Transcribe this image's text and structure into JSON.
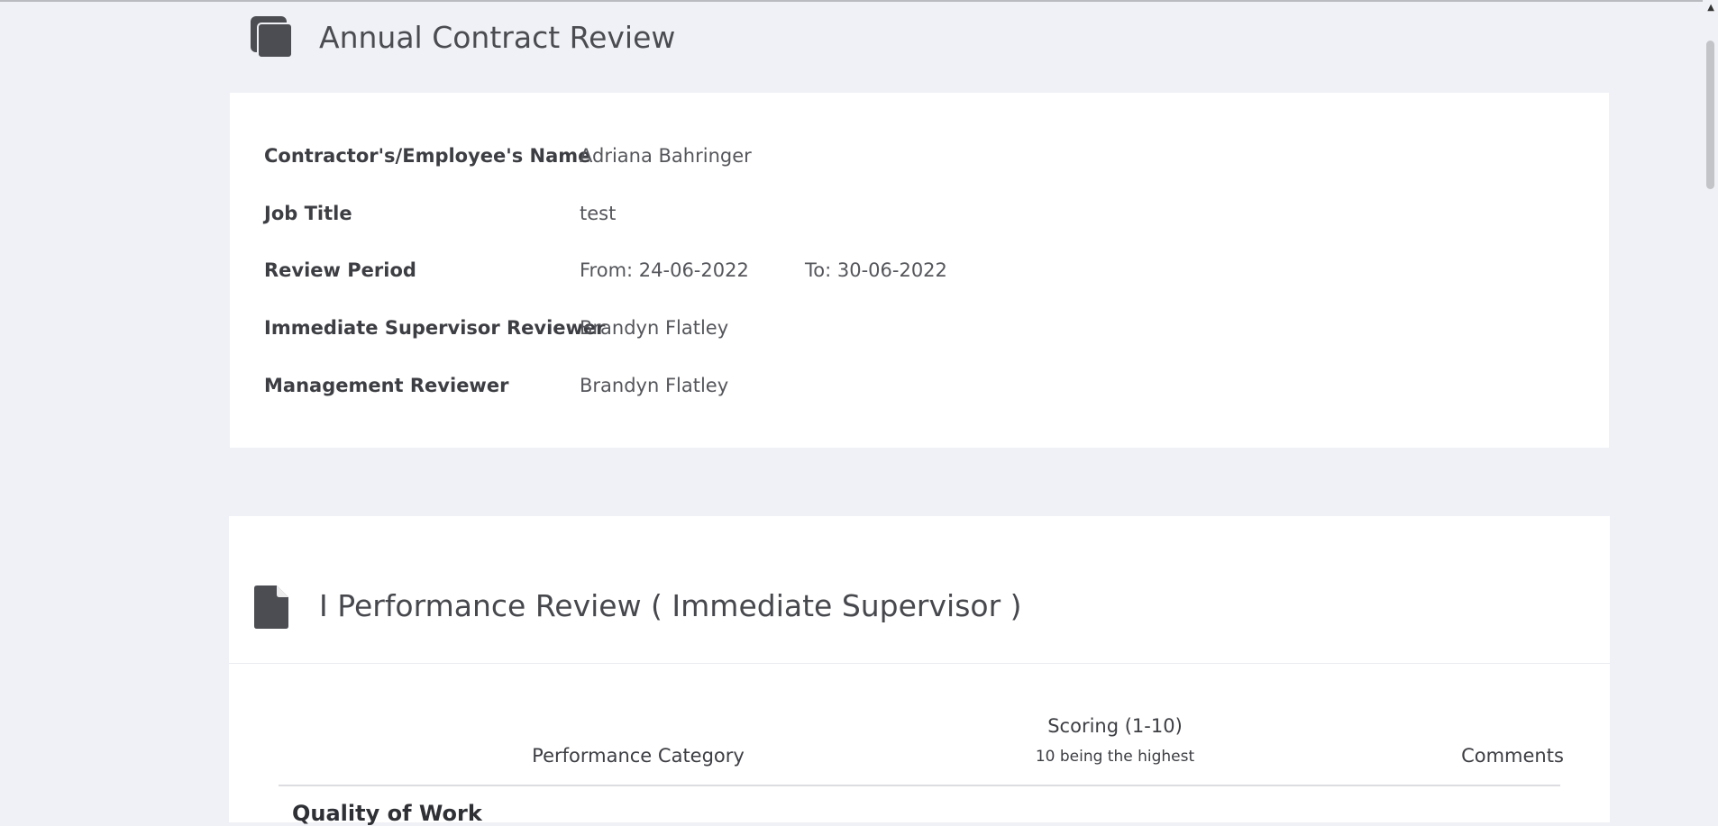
{
  "page": {
    "title": "Annual Contract Review",
    "title_icon": "copy-icon"
  },
  "info": {
    "rows": [
      {
        "label": "Contractor's/Employee's Name",
        "value": "Adriana Bahringer"
      },
      {
        "label": "Job Title",
        "value": "test"
      },
      {
        "label": "Review Period",
        "value": "From: 24-06-2022",
        "value2": "To: 30-06-2022"
      },
      {
        "label": "Immediate Supervisor Reviewer",
        "value": "Brandyn Flatley"
      },
      {
        "label": "Management Reviewer",
        "value": "Brandyn Flatley"
      }
    ]
  },
  "section": {
    "icon": "file-icon",
    "title": "I Performance Review ( Immediate Supervisor )",
    "table": {
      "headers": {
        "category": "Performance Category",
        "scoring": "Scoring (1-10)",
        "scoring_sub": "10 being the highest",
        "comments": "Comments"
      },
      "first_row_partial": "Quality of Work"
    }
  },
  "colors": {
    "background": "#f0f1f6",
    "card": "#ffffff",
    "icon": "#4b4d52"
  }
}
